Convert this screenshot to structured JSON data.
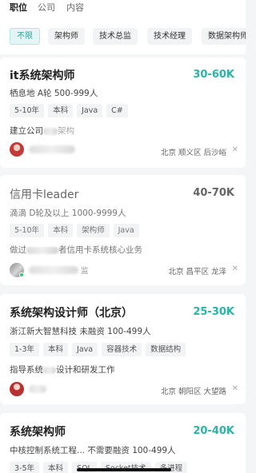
{
  "top_tabs": [
    "职位",
    "公司",
    "内容"
  ],
  "filters": [
    "不限",
    "架构师",
    "技术总监",
    "技术经理",
    "数据架构师"
  ],
  "jobs": [
    {
      "title": "it系统架构师",
      "salary": "30-60K",
      "company": "栖息地 A轮 500-999人",
      "tags": [
        "5-10年",
        "本科",
        "Java",
        "C#"
      ],
      "desc": "建立公司",
      "desc_tail": "架构",
      "location": "北京 顺义区 后沙峪"
    },
    {
      "title": "信用卡leader",
      "salary": "40-70K",
      "company": "滴滴 D轮及以上 1000-9999人",
      "tags": [
        "5-10年",
        "本科",
        "架构师",
        "Java"
      ],
      "desc": "做过",
      "desc_tail": "者信用卡系统核心业务",
      "recruiter_suffix": "监",
      "location": "北京 昌平区 龙泽"
    },
    {
      "title": "系统架构设计师（北京）",
      "salary": "25-30K",
      "company": "浙江新大智慧科技 未融资 100-499人",
      "tags": [
        "1-3年",
        "本科",
        "Java",
        "容器技术",
        "数据结构"
      ],
      "desc": "指导系统",
      "desc_tail": "设计和研发工作",
      "location": "北京 朝阳区 大望路"
    },
    {
      "title": "系统架构师",
      "salary": "20-40K",
      "company": "中核控制系统工程... 不需要融资 100-499人",
      "tags": [
        "3-5年",
        "本科",
        "SQL",
        "Socket技术",
        "多进程"
      ]
    }
  ],
  "close_glyph": "✕",
  "colors": {
    "accent": "#2cb3a6",
    "chip_selected_bg": "#e3f6f5"
  }
}
